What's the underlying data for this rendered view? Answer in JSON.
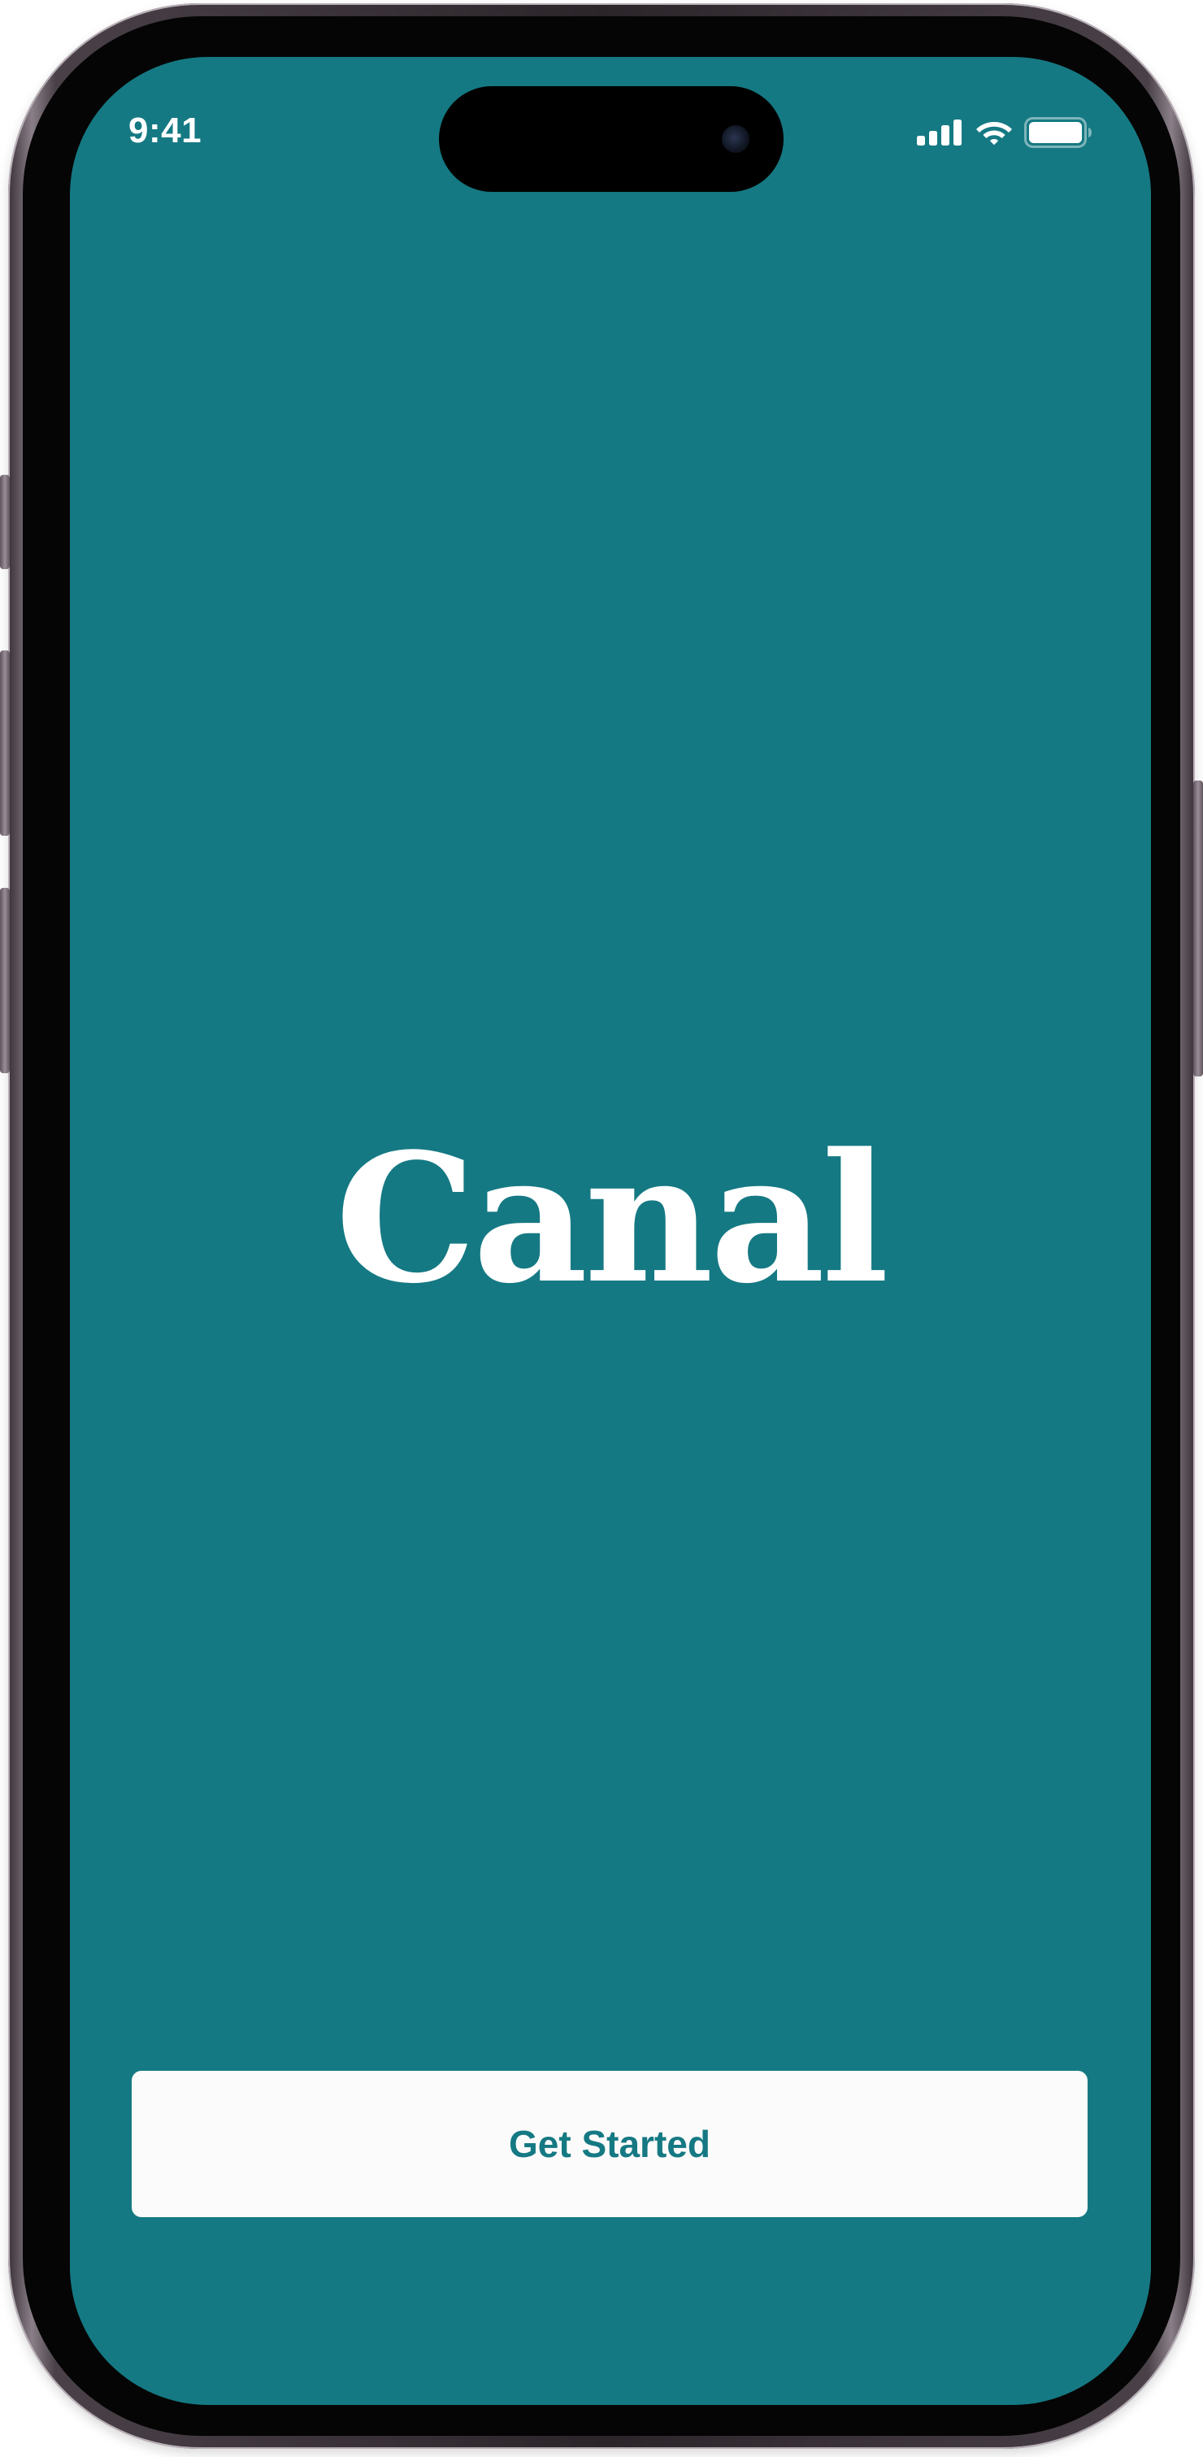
{
  "status_bar": {
    "time": "9:41",
    "icons": [
      "cellular-signal-icon",
      "wifi-icon",
      "battery-icon"
    ]
  },
  "app": {
    "logo": "Canal",
    "primary_action_label": "Get Started"
  },
  "colors": {
    "background": "#157983",
    "button_background": "#fbfbfb",
    "button_text": "#157983",
    "foreground": "#ffffff"
  }
}
